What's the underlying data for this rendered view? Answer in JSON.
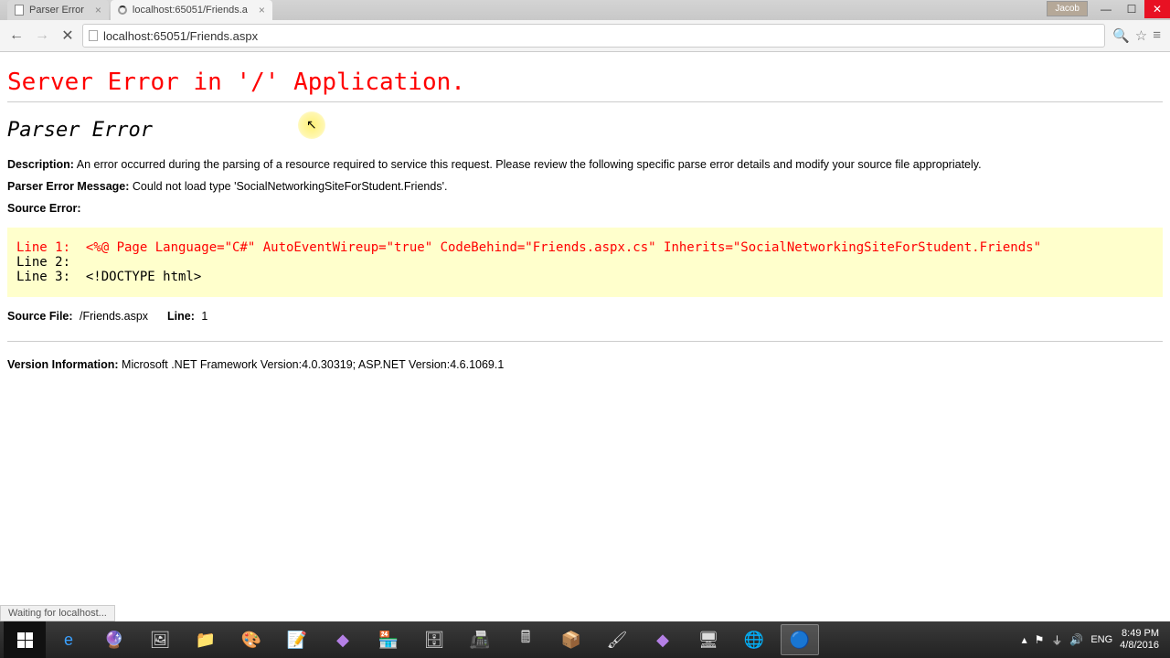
{
  "window": {
    "user_badge": "Jacob"
  },
  "tabs": [
    {
      "title": "Parser Error",
      "active": false
    },
    {
      "title": "localhost:65051/Friends.a",
      "active": true
    }
  ],
  "url": "localhost:65051/Friends.aspx",
  "page": {
    "heading": "Server Error in '/' Application.",
    "subheading": "Parser Error",
    "description_label": "Description:",
    "description_text": "An error occurred during the parsing of a resource required to service this request. Please review the following specific parse error details and modify your source file appropriately.",
    "parser_msg_label": "Parser Error Message:",
    "parser_msg_text": "Could not load type 'SocialNetworkingSiteForStudent.Friends'.",
    "source_error_label": "Source Error:",
    "code": {
      "line1": "Line 1:  <%@ Page Language=\"C#\" AutoEventWireup=\"true\" CodeBehind=\"Friends.aspx.cs\" Inherits=\"SocialNetworkingSiteForStudent.Friends\"",
      "line2": "Line 2:  ",
      "line3": "Line 3:  <!DOCTYPE html>"
    },
    "source_file_label": "Source File:",
    "source_file_value": "/Friends.aspx",
    "line_label": "Line:",
    "line_value": "1",
    "version_label": "Version Information:",
    "version_text": "Microsoft .NET Framework Version:4.0.30319; ASP.NET Version:4.6.1069.1"
  },
  "status_text": "Waiting for localhost...",
  "tray": {
    "lang": "ENG",
    "time": "8:49 PM",
    "date": "4/8/2016"
  }
}
